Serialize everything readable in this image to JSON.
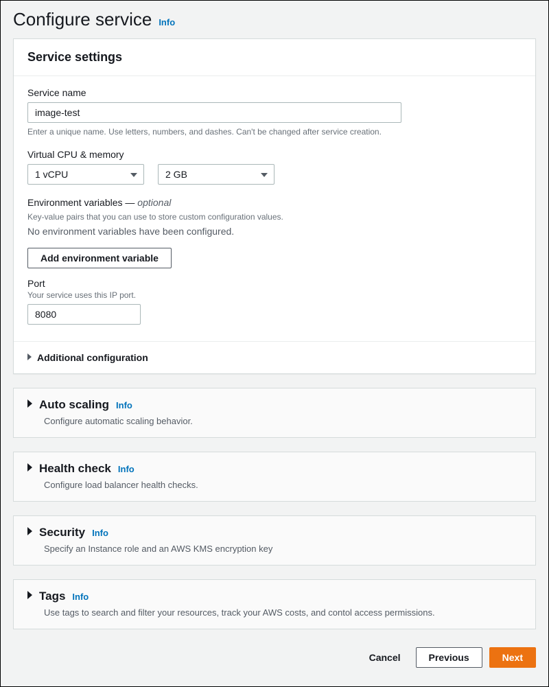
{
  "header": {
    "title": "Configure service",
    "info": "Info"
  },
  "service_settings": {
    "title": "Service settings",
    "service_name": {
      "label": "Service name",
      "value": "image-test",
      "help": "Enter a unique name. Use letters, numbers, and dashes. Can't be changed after service creation."
    },
    "vcpu_memory": {
      "label": "Virtual CPU & memory",
      "vcpu_value": "1 vCPU",
      "memory_value": "2 GB"
    },
    "env": {
      "label_prefix": "Environment variables — ",
      "optional": "optional",
      "help": "Key-value pairs that you can use to store custom configuration values.",
      "empty_text": "No environment variables have been configured.",
      "add_button": "Add environment variable"
    },
    "port": {
      "label": "Port",
      "help": "Your service uses this IP port.",
      "value": "8080"
    },
    "additional_config": "Additional configuration"
  },
  "sections": {
    "auto_scaling": {
      "title": "Auto scaling",
      "info": "Info",
      "desc": "Configure automatic scaling behavior."
    },
    "health_check": {
      "title": "Health check",
      "info": "Info",
      "desc": "Configure load balancer health checks."
    },
    "security": {
      "title": "Security",
      "info": "Info",
      "desc": "Specify an Instance role and an AWS KMS encryption key"
    },
    "tags": {
      "title": "Tags",
      "info": "Info",
      "desc": "Use tags to search and filter your resources, track your AWS costs, and contol access permissions."
    }
  },
  "footer": {
    "cancel": "Cancel",
    "previous": "Previous",
    "next": "Next"
  }
}
